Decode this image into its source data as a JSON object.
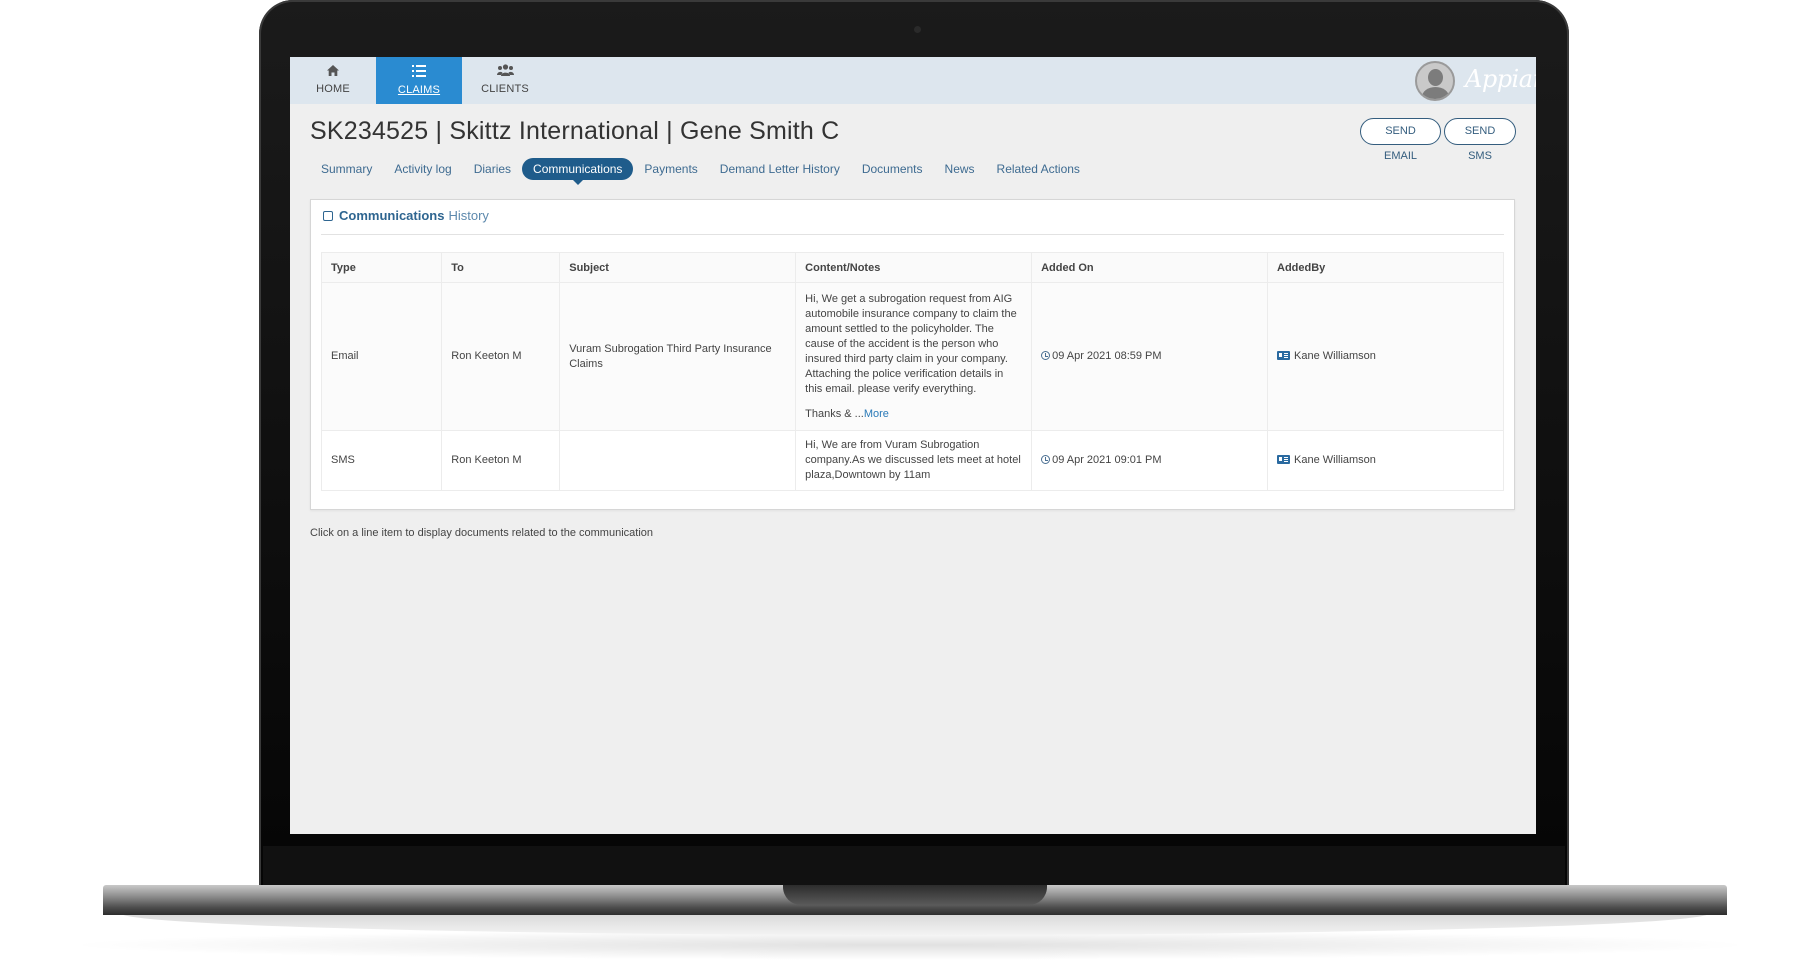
{
  "nav": {
    "items": [
      {
        "label": "HOME",
        "icon": "home-icon"
      },
      {
        "label": "CLAIMS",
        "icon": "list-icon"
      },
      {
        "label": "CLIENTS",
        "icon": "users-icon"
      }
    ],
    "active": "CLAIMS"
  },
  "brand": {
    "name": "Appian"
  },
  "header": {
    "title": "SK234525 | Skittz International | Gene Smith C",
    "send_email_label": "SEND EMAIL",
    "send_sms_label": "SEND SMS"
  },
  "tabs": [
    {
      "label": "Summary"
    },
    {
      "label": "Activity log"
    },
    {
      "label": "Diaries"
    },
    {
      "label": "Communications"
    },
    {
      "label": "Payments"
    },
    {
      "label": "Demand Letter History"
    },
    {
      "label": "Documents"
    },
    {
      "label": "News"
    },
    {
      "label": "Related Actions"
    }
  ],
  "active_tab": "Communications",
  "card": {
    "title_bold": "Communications",
    "title_light": "History"
  },
  "table": {
    "columns": [
      "Type",
      "To",
      "Subject",
      "Content/Notes",
      "Added On",
      "AddedBy"
    ],
    "rows": [
      {
        "type": "Email",
        "to": "Ron Keeton M",
        "subject": "Vuram Subrogation Third Party Insurance Claims",
        "content": "Hi, We get a subrogation request from AIG automobile insurance company to claim the amount settled to the policyholder. The cause of the accident is the person who insured third party claim in your company. Attaching the police verification details in this email. please verify everything.",
        "content_tail": "Thanks & ...",
        "more_label": "More",
        "added_on": "09 Apr 2021 08:59 PM",
        "added_by": "Kane Williamson"
      },
      {
        "type": "SMS",
        "to": "Ron Keeton M",
        "subject": "",
        "content": "Hi, We are from Vuram Subrogation company.As we discussed lets meet at hotel plaza,Downtown by 11am",
        "added_on": "09 Apr 2021 09:01 PM",
        "added_by": "Kane Williamson"
      }
    ]
  },
  "footnote": "Click on a line item to display documents related to the communication",
  "colors": {
    "nav_active": "#2a8bd1",
    "tab_active": "#1f5c8b",
    "link": "#2a7ab8",
    "topbar": "#dde6ee"
  }
}
